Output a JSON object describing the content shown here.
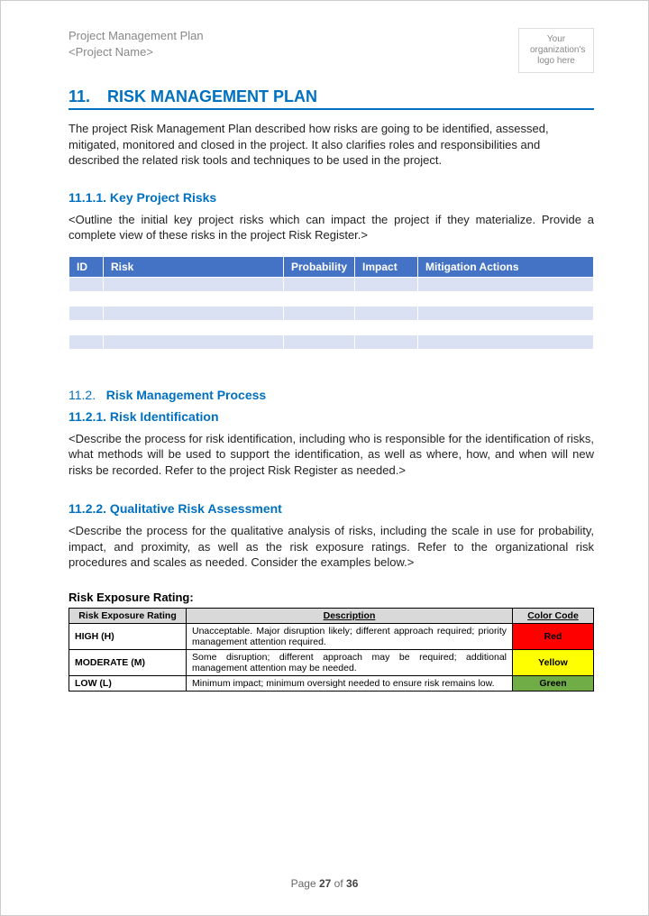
{
  "header": {
    "line1": "Project Management Plan",
    "line2": "<Project Name>",
    "logo_text": "Your organization's logo here"
  },
  "section": {
    "number": "11.",
    "title": "RISK MANAGEMENT PLAN",
    "intro": "The project Risk Management Plan described how risks are going to be identified, assessed, mitigated, monitored and closed in the project. It also clarifies roles and responsibilities and described the related risk tools and techniques to be used in the project."
  },
  "s1111": {
    "heading": "11.1.1. Key Project Risks",
    "instruction": "<Outline the initial key project risks which can impact the project if they materialize. Provide a complete view of these risks in the project Risk Register.>",
    "cols": {
      "id": "ID",
      "risk": "Risk",
      "probability": "Probability",
      "impact": "Impact",
      "mitigation": "Mitigation Actions"
    }
  },
  "s112": {
    "num": "11.2.",
    "label": "Risk Management Process"
  },
  "s1121": {
    "heading": "11.2.1. Risk Identification",
    "instruction": "<Describe the process for risk identification, including who is responsible for the identification of risks, what methods will be used to support the identification, as well as where, how, and when will new risks be recorded. Refer to the project Risk Register as needed.>"
  },
  "s1122": {
    "heading": "11.2.2. Qualitative Risk Assessment",
    "instruction": "<Describe the process for the qualitative analysis of risks, including the scale in use for probability, impact, and proximity, as well as the risk exposure ratings. Refer to the organizational risk procedures and scales as needed. Consider the examples below.>"
  },
  "rating": {
    "label": "Risk Exposure Rating:",
    "headers": {
      "rating": "Risk Exposure Rating",
      "description": "Description",
      "color": "Color Code"
    },
    "rows": [
      {
        "level": "HIGH (H)",
        "desc": "Unacceptable. Major disruption likely; different approach required; priority management attention required.",
        "code": "Red",
        "cls": "red"
      },
      {
        "level": "MODERATE (M)",
        "desc": "Some disruption; different approach may be required; additional management attention may be needed.",
        "code": "Yellow",
        "cls": "yellow"
      },
      {
        "level": "LOW (L)",
        "desc": "Minimum impact; minimum oversight needed to ensure risk remains low.",
        "code": "Green",
        "cls": "green"
      }
    ]
  },
  "footer": {
    "prefix": "Page ",
    "current": "27",
    "of": " of ",
    "total": "36"
  }
}
